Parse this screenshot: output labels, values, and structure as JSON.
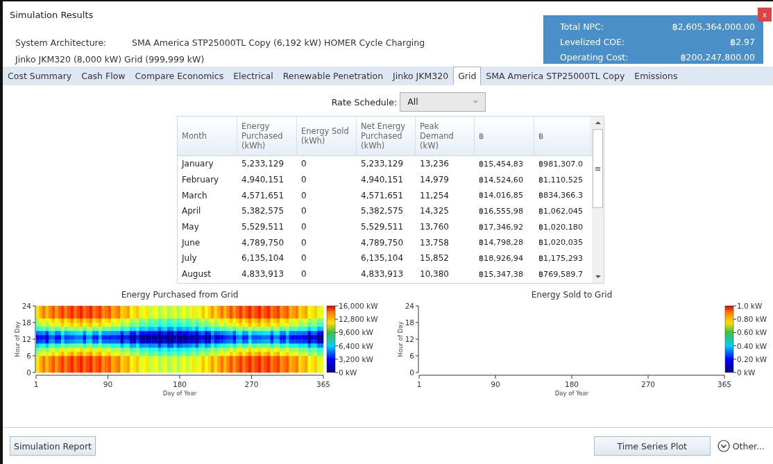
{
  "window": {
    "title": "Simulation Results",
    "close": "x"
  },
  "architecture": {
    "label": "System Architecture:",
    "line_1": "SMA America STP25000TL Copy (6,192 kW)  HOMER Cycle Charging",
    "line_2": "Jinko JKM320 (8,000 kW)  Grid (999,999 kW)"
  },
  "summary": [
    {
      "label": "Total NPC:",
      "value": "฿2,605,364,000.00"
    },
    {
      "label": "Levelized COE:",
      "value": "฿2.97"
    },
    {
      "label": "Operating Cost:",
      "value": "฿200,247,800.00"
    }
  ],
  "tabs": [
    {
      "label": "Cost Summary",
      "selected": false
    },
    {
      "label": "Cash Flow",
      "selected": false
    },
    {
      "label": "Compare Economics",
      "selected": false
    },
    {
      "label": "Electrical",
      "selected": false
    },
    {
      "label": "Renewable Penetration",
      "selected": false
    },
    {
      "label": "Jinko JKM320",
      "selected": false
    },
    {
      "label": "Grid",
      "selected": true
    },
    {
      "label": "SMA America STP25000TL Copy",
      "selected": false
    },
    {
      "label": "Emissions",
      "selected": false
    }
  ],
  "rate_schedule": {
    "label": "Rate Schedule:",
    "value": "All"
  },
  "table": {
    "columns": [
      "Month",
      "Energy Purchased (kWh)",
      "Energy Sold (kWh)",
      "Net Energy Purchased (kWh)",
      "Peak Demand (kW)",
      "฿",
      "฿"
    ],
    "rows": [
      [
        "January",
        "5,233,129",
        "0",
        "5,233,129",
        "13,236",
        "฿15,454,83",
        "฿981,307.0"
      ],
      [
        "February",
        "4,940,151",
        "0",
        "4,940,151",
        "14,979",
        "฿14,524,60",
        "฿1,110,525"
      ],
      [
        "March",
        "4,571,651",
        "0",
        "4,571,651",
        "11,254",
        "฿14,016,85",
        "฿834,366.3"
      ],
      [
        "April",
        "5,382,575",
        "0",
        "5,382,575",
        "14,325",
        "฿16,555,98",
        "฿1,062,045"
      ],
      [
        "May",
        "5,529,511",
        "0",
        "5,529,511",
        "13,760",
        "฿17,346,92",
        "฿1,020,180"
      ],
      [
        "June",
        "4,789,750",
        "0",
        "4,789,750",
        "13,758",
        "฿14,798,28",
        "฿1,020,035"
      ],
      [
        "July",
        "6,135,104",
        "0",
        "6,135,104",
        "15,852",
        "฿18,926,94",
        "฿1,175,293"
      ],
      [
        "August",
        "4,833,913",
        "0",
        "4,833,913",
        "10,380",
        "฿15,347,38",
        "฿769,589.7"
      ]
    ]
  },
  "charts": [
    {
      "kind": "filled",
      "title": "Energy Purchased from Grid",
      "ylabel": "Hour of Day",
      "xlabel": "Day of Year",
      "yticks": [
        "24",
        "18",
        "12",
        "6",
        "0"
      ],
      "xticks": [
        "1",
        "90",
        "180",
        "270",
        "365"
      ],
      "scale": [
        "16,000 kW",
        "12,800 kW",
        "9,600 kW",
        "6,400 kW",
        "3,200 kW",
        "0 kW"
      ]
    },
    {
      "kind": "empty",
      "title": "Energy Sold to Grid",
      "ylabel": "Hour of Day",
      "xlabel": "Day of Year",
      "yticks": [
        "24",
        "18",
        "12",
        "6",
        "0"
      ],
      "xticks": [
        "1",
        "90",
        "180",
        "270",
        "365"
      ],
      "scale": [
        "1.0 kW",
        "0.80 kW",
        "0.60 kW",
        "0.40 kW",
        "0.20 kW",
        "0 kW"
      ]
    }
  ],
  "footer": {
    "report_button": "Simulation Report",
    "plot_button": "Time Series Plot",
    "other": "Other..."
  }
}
